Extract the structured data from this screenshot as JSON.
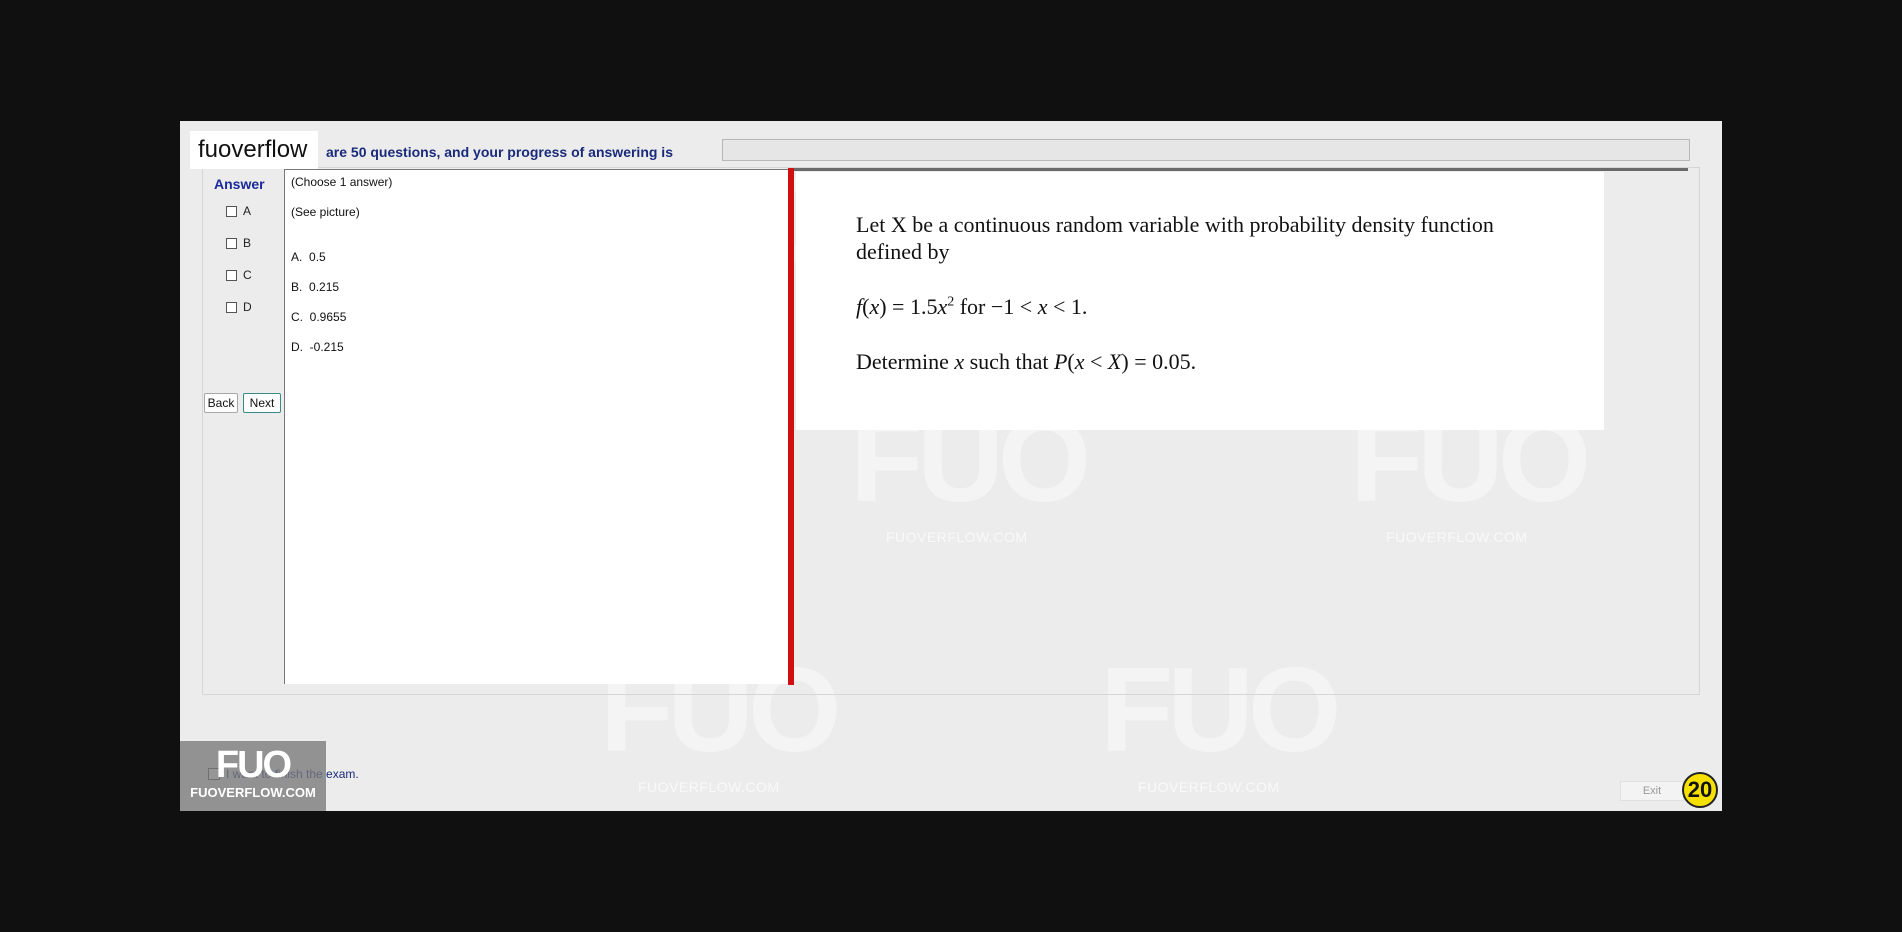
{
  "header": {
    "brand": "fuoverflow",
    "progress_label": "are 50 questions, and your progress of answering is",
    "progress_fraction": 0
  },
  "answer_panel": {
    "title": "Answer",
    "options": [
      "A",
      "B",
      "C",
      "D"
    ],
    "back_label": "Back",
    "next_label": "Next"
  },
  "question_text": {
    "instruction": "(Choose 1 answer)",
    "see_picture": "(See picture)",
    "choices": [
      {
        "letter": "A.",
        "value": "0.5"
      },
      {
        "letter": "B.",
        "value": "0.215"
      },
      {
        "letter": "C.",
        "value": "0.9655"
      },
      {
        "letter": "D.",
        "value": "-0.215"
      }
    ]
  },
  "question_image": {
    "line1": "Let X be a continuous random variable with probability density function",
    "line2": "defined by",
    "formula": "f(x) = 1.5x² for −1 < x < 1.",
    "line3": "Determine x such that P(x < X) = 0.05."
  },
  "footer": {
    "finish_label": "I want to finish the exam.",
    "exit_label": "Exit",
    "counter": "20"
  },
  "watermark": {
    "logo": "FUO",
    "site": "FUOVERFLOW.COM"
  },
  "colors": {
    "splitter": "#d01010",
    "label_blue": "#1a2a7a",
    "counter_bg": "#f5e000"
  }
}
